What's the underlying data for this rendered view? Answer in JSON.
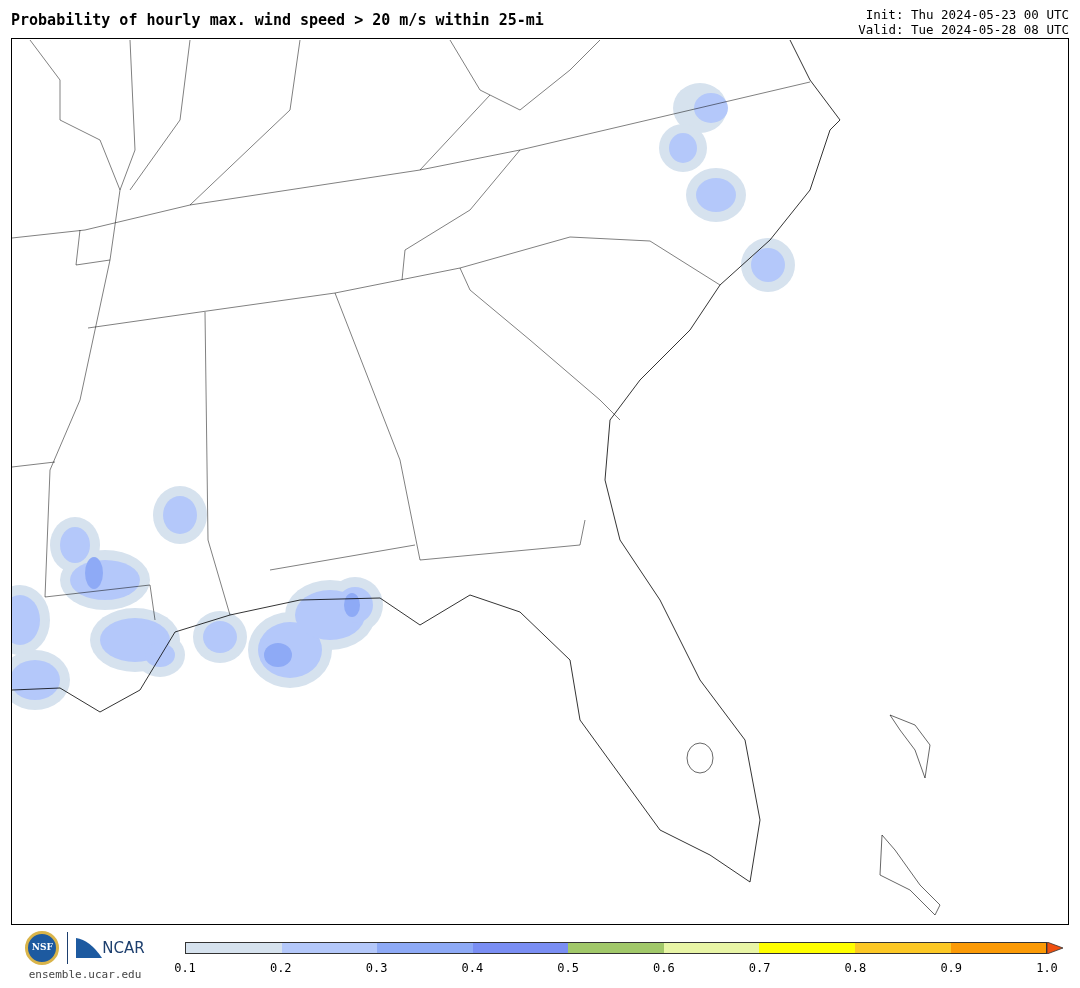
{
  "title": "Probability of hourly max. wind speed > 20 m/s within 25-mi",
  "init": "Init: Thu 2024-05-23 00 UTC",
  "valid": "Valid: Tue 2024-05-28 08 UTC",
  "logos": {
    "nsf": "NSF",
    "ncar": "NCAR",
    "url": "ensemble.ucar.edu"
  },
  "colorbar": {
    "bins": [
      {
        "kind": "bin",
        "color": "#d6e2ee"
      },
      {
        "kind": "bin",
        "color": "#b4c8fa"
      },
      {
        "kind": "bin",
        "color": "#8eaaf6"
      },
      {
        "kind": "bin",
        "color": "#7a8ef3"
      },
      {
        "kind": "bin",
        "color": "#a1c86a"
      },
      {
        "kind": "bin",
        "color": "#e8f5a6"
      },
      {
        "kind": "bin",
        "color": "#ffff00"
      },
      {
        "kind": "bin",
        "color": "#fcc825"
      },
      {
        "kind": "bin",
        "color": "#fb9a06"
      },
      {
        "kind": "arrow",
        "color": "#ef4f0f"
      }
    ],
    "ticks": [
      "0.1",
      "0.2",
      "0.3",
      "0.4",
      "0.5",
      "0.6",
      "0.7",
      "0.8",
      "0.9",
      "1.0"
    ]
  }
}
